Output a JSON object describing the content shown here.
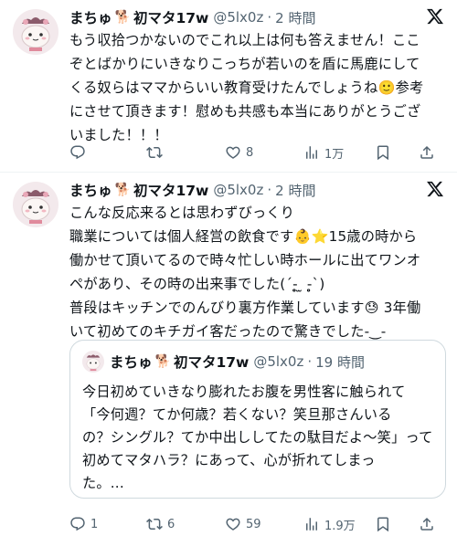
{
  "tweets": [
    {
      "author_name": "まちゅ",
      "pet_emoji": "🐕",
      "author_name_suffix": "初マタ17w",
      "handle": "@5lx0z",
      "separator": "·",
      "time": "2 時間",
      "text": "もう収拾つかないのでこれ以上は何も答えません！ここぞとばかりにいきなりこっちが若いのを盾に馬鹿にしてくる奴らはママからいい教育受けたんでしょうね🙂参考にさせて頂きます！慰めも共感も本当にありがとうございました！！！",
      "text_lines": [
        "もう収拾つかないのでこれ以上は何も答えません！ここ",
        "ぞとばかりにいきなりこっちが若いのを盾に馬鹿にして",
        "くる奴らはママからいい教育受けたんでしょうね🙂参考",
        "にさせて頂きます！慰めも共感も本当にありがとうござ",
        "いました！！！"
      ],
      "replies": "",
      "retweets": "",
      "likes": "8",
      "views": "1万"
    },
    {
      "author_name": "まちゅ",
      "pet_emoji": "🐕",
      "author_name_suffix": "初マタ17w",
      "handle": "@5lx0z",
      "separator": "·",
      "time": "2 時間",
      "text_lines": [
        "こんな反応来るとは思わずびっくり",
        "職業については個人経営の飲食です👶⭐15歳の時から",
        "働かせて頂いてるので時々忙しい時ホールに出てワンオ",
        "ペがあり、その時の出来事でした(´-̥̥̥ ̫ -̥̥̥`)",
        "普段はキッチンでのんびり裏方作業しています😓 3年働",
        "いて初めてのキチガイ客だったので驚きでした-‿-"
      ],
      "quote": {
        "author_name": "まちゅ",
        "pet_emoji": "🐕",
        "author_name_suffix": "初マタ17w",
        "handle": "@5lx0z",
        "separator": "·",
        "time": "19 時間",
        "text_lines": [
          "今日初めていきなり膨れたお腹を男性客に触られて",
          "「今何週？てか何歳？若くない？笑旦那さんいる",
          "の？シングル？てか中出ししてたの駄目だよ〜笑」って",
          "初めてマタハラ？にあって、心が折れてしまっ",
          "た。..."
        ]
      },
      "replies": "1",
      "retweets": "6",
      "likes": "59",
      "views": "1.9万"
    }
  ],
  "icons": {
    "x_logo": "x-logo-icon",
    "reply": "reply-icon",
    "retweet": "retweet-icon",
    "like": "heart-icon",
    "views": "views-icon",
    "bookmark": "bookmark-icon",
    "share": "share-icon"
  },
  "colors": {
    "text": "#0f1419",
    "secondary": "#536471",
    "border": "#cfd9de"
  }
}
